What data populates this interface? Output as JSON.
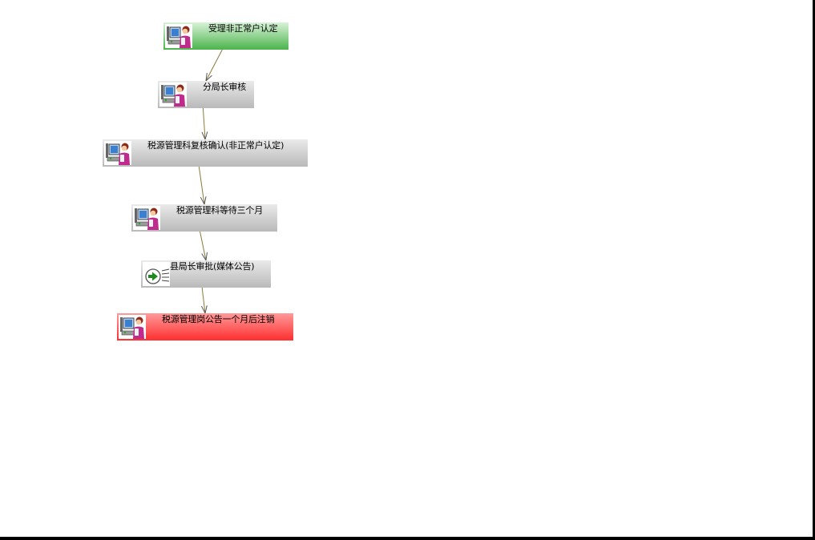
{
  "nodes": [
    {
      "id": "n1",
      "label": "受理非正常户认定",
      "type": "start",
      "icon": "person-at-computer-icon"
    },
    {
      "id": "n2",
      "label": "分局长审核",
      "type": "task",
      "icon": "person-at-computer-icon"
    },
    {
      "id": "n3",
      "label": "税源管理科复核确认(非正常户认定)",
      "type": "task",
      "icon": "person-at-computer-icon"
    },
    {
      "id": "n4",
      "label": "税源管理科等待三个月",
      "type": "task",
      "icon": "person-at-computer-icon"
    },
    {
      "id": "n5",
      "label": "县局长审批(媒体公告)",
      "type": "auto",
      "icon": "arrow-go-icon"
    },
    {
      "id": "n6",
      "label": "税源管理岗公告一个月后注销",
      "type": "end",
      "icon": "person-at-computer-icon"
    }
  ],
  "edges": [
    {
      "from": "n1",
      "to": "n2"
    },
    {
      "from": "n2",
      "to": "n3"
    },
    {
      "from": "n3",
      "to": "n4"
    },
    {
      "from": "n4",
      "to": "n5"
    },
    {
      "from": "n5",
      "to": "n6"
    }
  ],
  "colors": {
    "start": "#4bb44b",
    "end": "#ff2e2e",
    "task": "#b9b9b9",
    "edge": "#8a7a3a"
  }
}
